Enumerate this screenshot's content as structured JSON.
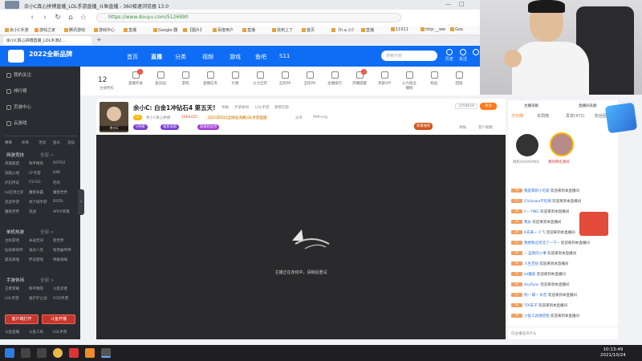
{
  "browser": {
    "window_title": "余小C真心拼搏直播_LOL手游直播_斗鱼直播 - 360极速浏览器 13.0",
    "url": "https://www.douyu.com/5126990",
    "tab_title": "余小C真心拼搏直播_LOL手游2...",
    "bookmarks": [
      "余小C手游",
      "游戏之家",
      "腾讯游戏",
      "游戏中心",
      "直播",
      "Google 翻",
      "【图片】",
      "百度用户",
      "直播",
      "找到上了",
      "首页",
      "《h.a.小》",
      "直播",
      "11011",
      "http:__ww",
      "Goo"
    ]
  },
  "site": {
    "logo_text": "2022全新品牌",
    "nav": [
      "首页",
      "直播",
      "分类",
      "视频",
      "游戏",
      "鱼吧",
      "S11"
    ],
    "search_placeholder": "搜索内容",
    "header_icons": [
      "历史",
      "关注",
      "创作",
      "下载"
    ]
  },
  "sidebar": {
    "top_items": [
      "我的关注",
      "排行榜",
      "页游中心",
      "云游戏"
    ],
    "gift_row": [
      "赛事",
      "体育",
      "活动",
      "鱼乐",
      "竞技"
    ],
    "sections": [
      {
        "title": "网游竞技",
        "more": "全部 >",
        "games": [
          "英雄联盟",
          "和平精英",
          "DOTA2",
          "穿越火线",
          "CF手游",
          "DNF",
          "炉石传说",
          "CS:GO",
          "吃鸡",
          "lol云顶之弈",
          "魔兽争霸",
          "魔兽世界",
          "逆战手游",
          "地下城手游",
          "DOTA",
          "魔兽世界",
          "逆战",
          "APEX英雄"
        ]
      },
      {
        "title": "单机热游",
        "more": "全部 >",
        "games": [
          "主机游戏",
          "永劫无间",
          "新世界",
          "仙剑奇侠传",
          "鬼谷八荒",
          "暗黑破坏神",
          "孤岛惊魂",
          "怀旧游戏",
          "神秘海域"
        ]
      },
      {
        "title": "手游休闲",
        "more": "全部 >",
        "games": [
          "王者荣耀",
          "和平精英",
          "火影忍者",
          "LOL手游",
          "金铲铲之战",
          "COD手游"
        ]
      }
    ],
    "bottom_buttons": [
      "客户端打开",
      "斗鱼开播"
    ],
    "footer": [
      "斗鱼直播",
      "斗鱼工具",
      "LOL手游"
    ]
  },
  "categories": {
    "count": "12",
    "count_label": "主播特权",
    "items": [
      "直播开关",
      "鱼乐园",
      "游戏",
      "直播任务",
      "礼物",
      "火力全开",
      "全民PK",
      "全民PK",
      "主播排行",
      "开播提醒",
      "贵族VIP",
      "火力值主播榜",
      "粉丝",
      "回放"
    ],
    "badges": [
      "1",
      "2"
    ]
  },
  "room": {
    "streamer": "余小C",
    "title": "余小C: 白金1冲钻石4 第五天!",
    "meta": [
      "举报",
      "手游休闲",
      "LOL手游",
      "德莱厄斯"
    ],
    "level_tag": "LV",
    "team": "余小C真心拼搏",
    "hot": "1664455",
    "notice": "2021年S11全球总决赛LOL手游直播",
    "share": "分享",
    "fans": "999+kg",
    "follow_count": "3358618",
    "follow_label": "关注",
    "tags": [
      "V热榜",
      "福星高照",
      "超级粉丝团"
    ],
    "right_tag": "新春福利",
    "right_actions": [
      "举报",
      "客户端看",
      "弹幕礼物"
    ]
  },
  "video": {
    "loading_text": "主播正在连线中，请稍后重试"
  },
  "chat": {
    "header_left": "主播贡献",
    "header_right": "直播间贡献",
    "tabs": [
      "今日榜",
      "本周榜",
      "贵宾(472)",
      "粉丝团"
    ],
    "top_users": [
      "随机SHENDING",
      "我的网名真好"
    ],
    "lines": [
      {
        "lv": "29",
        "name": "我是萌新小可爱",
        "text": "欢迎来到本直播间"
      },
      {
        "lv": "27",
        "name": "Chiikawa不吃辣",
        "text": "欢迎来到本直播间"
      },
      {
        "lv": "30",
        "name": "F~ YING",
        "text": "欢迎来到本直播间"
      },
      {
        "lv": "32",
        "name": "我永",
        "text": "欢迎来到本直播间"
      },
      {
        "lv": "29",
        "name": "K先来~ 少飞",
        "text": "欢迎来到本直播间"
      },
      {
        "lv": "27",
        "name": "我想和这风流了一下~",
        "text": "欢迎来到本直播间"
      },
      {
        "lv": "30",
        "name": "✓ 蓝鹊的小事",
        "text": "欢迎来到本直播间"
      },
      {
        "lv": "35",
        "name": "人生苦短",
        "text": "欢迎来到本直播间"
      },
      {
        "lv": "27",
        "name": "lol魔族",
        "text": "欢迎来到本直播间"
      },
      {
        "lv": "30",
        "name": "zhyRyan",
        "text": "欢迎来到本直播间"
      },
      {
        "lv": "27",
        "name": "阿~ 鲸~ 抖音",
        "text": "欢迎来到本直播间"
      },
      {
        "lv": "30",
        "name": "TOI末子",
        "text": "欢迎来到本直播间"
      },
      {
        "lv": "35",
        "name": "小鱼工具哈哈哈",
        "text": "欢迎来到本直播间"
      }
    ],
    "input_hint": "向主播说点什么"
  },
  "taskbar": {
    "time": "10:13:49",
    "date": "2021/10/24"
  },
  "colors": {
    "brand_blue": "#0f6cf5",
    "sidebar_bg": "#2a2c31",
    "accent_orange": "#ff7a1a",
    "video_bg": "#2a2a2c"
  }
}
